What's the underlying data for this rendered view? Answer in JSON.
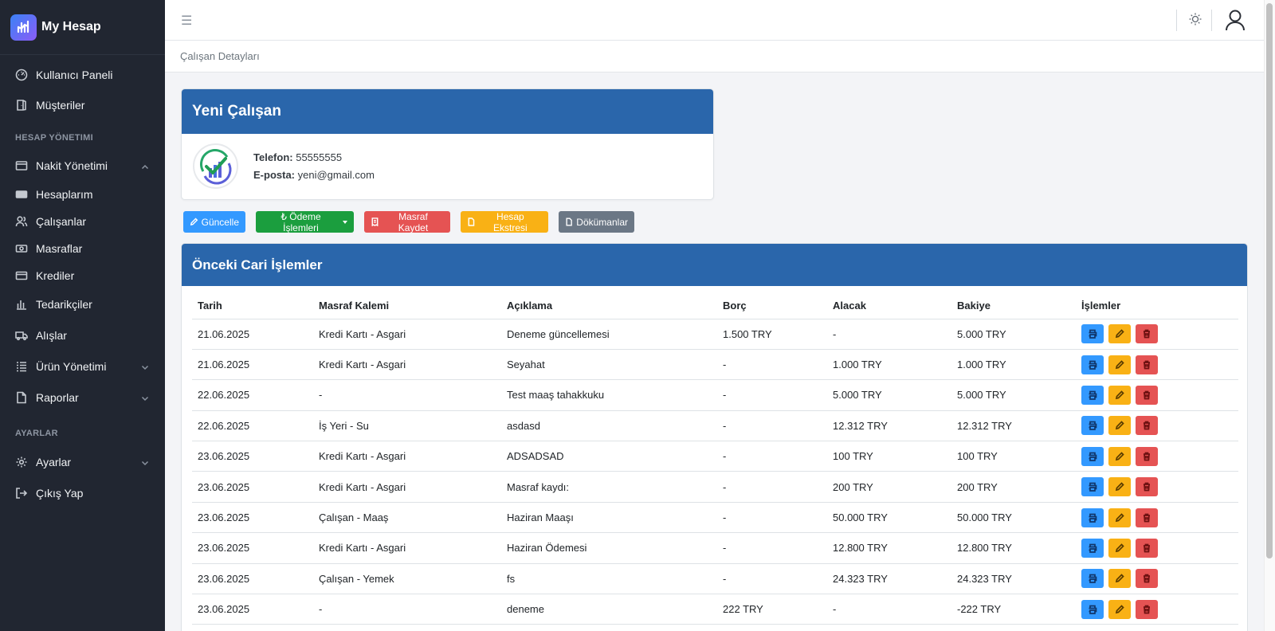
{
  "app": {
    "name": "My Hesap"
  },
  "sidebar": {
    "items_top": [
      {
        "label": "Kullanıcı Paneli",
        "icon": "speedometer-icon"
      },
      {
        "label": "Müşteriler",
        "icon": "door-icon"
      }
    ],
    "section_account": "HESAP YÖNETIMI",
    "items_account": [
      {
        "label": "Nakit Yönetimi",
        "icon": "wallet-icon",
        "chevron": "up"
      },
      {
        "label": "Hesaplarım",
        "icon": "card-icon"
      },
      {
        "label": "Çalışanlar",
        "icon": "people-icon"
      },
      {
        "label": "Masraflar",
        "icon": "money-icon"
      },
      {
        "label": "Krediler",
        "icon": "credit-card-icon"
      },
      {
        "label": "Tedarikçiler",
        "icon": "bar-chart-icon"
      },
      {
        "label": "Alışlar",
        "icon": "truck-icon"
      },
      {
        "label": "Ürün Yönetimi",
        "icon": "list-icon",
        "chevron": "down"
      },
      {
        "label": "Raporlar",
        "icon": "file-icon",
        "chevron": "down"
      }
    ],
    "section_settings": "AYARLAR",
    "items_settings": [
      {
        "label": "Ayarlar",
        "icon": "gear-icon",
        "chevron": "down"
      },
      {
        "label": "Çıkış Yap",
        "icon": "logout-icon"
      }
    ]
  },
  "breadcrumb": "Çalışan Detayları",
  "employee": {
    "title": "Yeni Çalışan",
    "phone_label": "Telefon:",
    "phone": "55555555",
    "email_label": "E-posta:",
    "email": "yeni@gmail.com"
  },
  "actions": {
    "update": "Güncelle",
    "payments": "₺ Ödeme İşlemleri",
    "expense": "Masraf Kaydet",
    "statement": "Hesap Ekstresi",
    "documents": "Dökümanlar"
  },
  "transactions": {
    "title": "Önceki Cari İşlemler",
    "columns": [
      "Tarih",
      "Masraf Kalemi",
      "Açıklama",
      "Borç",
      "Alacak",
      "Bakiye",
      "İşlemler"
    ],
    "rows": [
      [
        "21.06.2025",
        "Kredi Kartı - Asgari",
        "Deneme güncellemesi",
        "1.500 TRY",
        "-",
        "5.000 TRY"
      ],
      [
        "21.06.2025",
        "Kredi Kartı - Asgari",
        "Seyahat",
        "-",
        "1.000 TRY",
        "1.000 TRY"
      ],
      [
        "22.06.2025",
        "-",
        "Test maaş tahakkuku",
        "-",
        "5.000 TRY",
        "5.000 TRY"
      ],
      [
        "22.06.2025",
        "İş Yeri - Su",
        "asdasd",
        "-",
        "12.312 TRY",
        "12.312 TRY"
      ],
      [
        "23.06.2025",
        "Kredi Kartı - Asgari",
        "ADSADSAD",
        "-",
        "100 TRY",
        "100 TRY"
      ],
      [
        "23.06.2025",
        "Kredi Kartı - Asgari",
        "Masraf kaydı:",
        "-",
        "200 TRY",
        "200 TRY"
      ],
      [
        "23.06.2025",
        "Çalışan - Maaş",
        "Haziran Maaşı",
        "-",
        "50.000 TRY",
        "50.000 TRY"
      ],
      [
        "23.06.2025",
        "Kredi Kartı - Asgari",
        "Haziran Ödemesi",
        "-",
        "12.800 TRY",
        "12.800 TRY"
      ],
      [
        "23.06.2025",
        "Çalışan - Yemek",
        "fs",
        "-",
        "24.323 TRY",
        "24.323 TRY"
      ],
      [
        "23.06.2025",
        "-",
        "deneme",
        "222 TRY",
        "-",
        "-222 TRY"
      ]
    ]
  },
  "colors": {
    "sidebar_bg": "#212631",
    "card_header": "#2a66ab",
    "info": "#3399ff",
    "success": "#1b9e3e",
    "danger": "#e55353",
    "warning": "#f9b115",
    "secondary": "#6b7785"
  }
}
